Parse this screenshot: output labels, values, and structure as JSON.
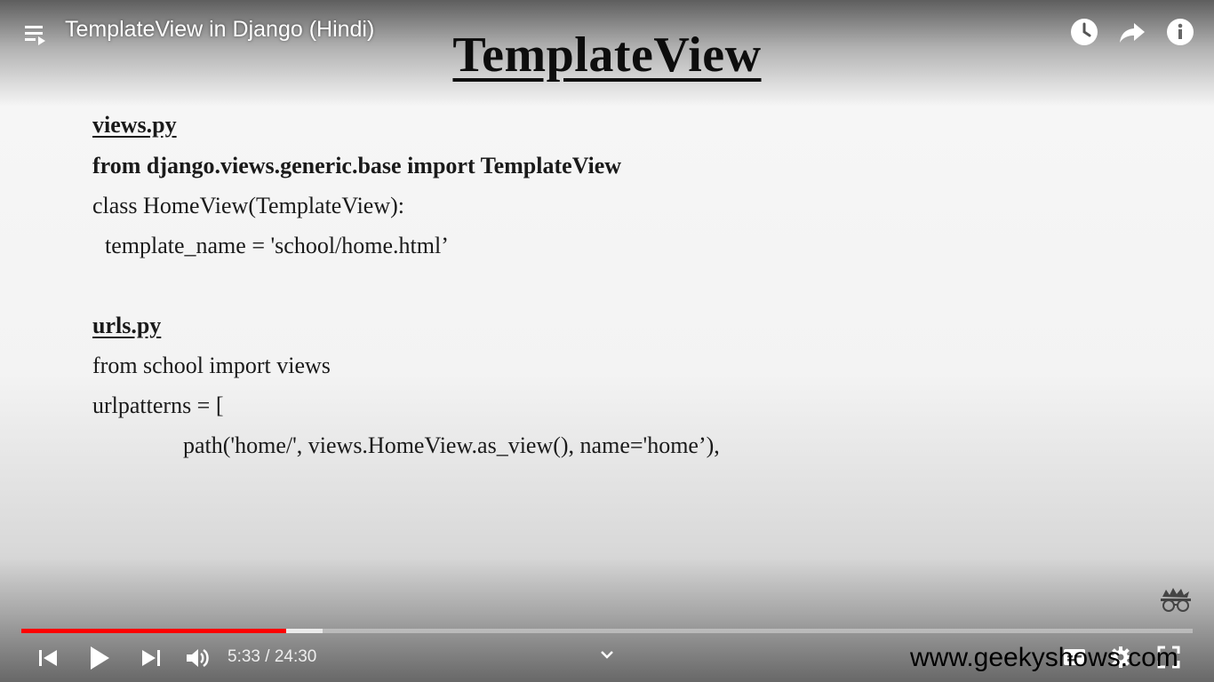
{
  "player": {
    "title": "TemplateView in Django (Hindi)",
    "time_display": "5:33 / 24:30",
    "progress_fraction": 0.2262,
    "buffered_fraction": 0.2575,
    "accent_color": "#ff0000"
  },
  "slide": {
    "title": "TemplateView",
    "views_heading": "views.py",
    "views_lines": [
      "from django.views.generic.base import TemplateView",
      "class HomeView(TemplateView):",
      "template_name = 'school/home.html’"
    ],
    "urls_heading": "urls.py",
    "urls_lines": [
      "from school import views",
      "urlpatterns = [",
      "path('home/', views.HomeView.as_view(), name='home’),"
    ]
  },
  "watermark": "www.geekyshows.com",
  "icons": {
    "playlist": "playlist-icon",
    "watch_later": "clock-icon",
    "share": "share-icon",
    "info": "info-icon",
    "previous": "previous-icon",
    "play": "play-icon",
    "next": "next-icon",
    "volume": "volume-icon",
    "chevron": "chevron-down-icon",
    "captions": "captions-icon",
    "settings": "gear-icon",
    "fullscreen": "fullscreen-icon",
    "logo": "geekyshows-logo-icon"
  }
}
